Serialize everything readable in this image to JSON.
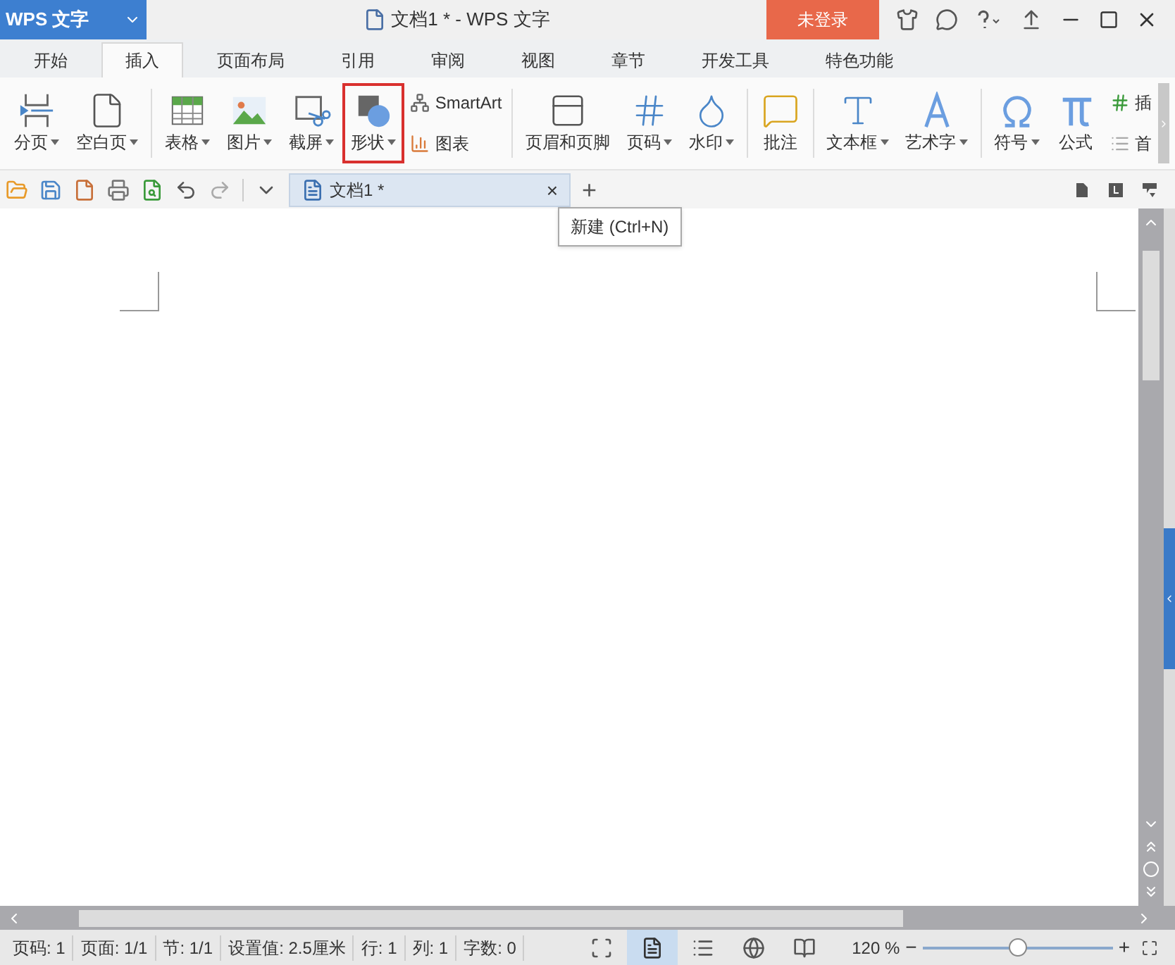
{
  "app_menu": {
    "label": "WPS 文字"
  },
  "window": {
    "title": "文档1 * - WPS 文字"
  },
  "login_button": {
    "label": "未登录"
  },
  "tabs": [
    {
      "label": "开始",
      "selected": false
    },
    {
      "label": "插入",
      "selected": true
    },
    {
      "label": "页面布局",
      "selected": false
    },
    {
      "label": "引用",
      "selected": false
    },
    {
      "label": "审阅",
      "selected": false
    },
    {
      "label": "视图",
      "selected": false
    },
    {
      "label": "章节",
      "selected": false
    },
    {
      "label": "开发工具",
      "selected": false
    },
    {
      "label": "特色功能",
      "selected": false
    }
  ],
  "ribbon": [
    {
      "kind": "large",
      "label": "分页",
      "dropdown": true,
      "highlighted": false
    },
    {
      "kind": "large",
      "label": "空白页",
      "dropdown": true,
      "highlighted": false
    },
    {
      "kind": "separator"
    },
    {
      "kind": "large",
      "label": "表格",
      "dropdown": true,
      "highlighted": false
    },
    {
      "kind": "large",
      "label": "图片",
      "dropdown": true,
      "highlighted": false
    },
    {
      "kind": "large",
      "label": "截屏",
      "dropdown": true,
      "highlighted": false
    },
    {
      "kind": "large",
      "label": "形状",
      "dropdown": true,
      "highlighted": true
    },
    {
      "kind": "stacked",
      "items": [
        {
          "label": "SmartArt"
        },
        {
          "label": "图表"
        }
      ]
    },
    {
      "kind": "separator"
    },
    {
      "kind": "large",
      "label": "页眉和页脚",
      "dropdown": false,
      "highlighted": false
    },
    {
      "kind": "large",
      "label": "页码",
      "dropdown": true,
      "highlighted": false
    },
    {
      "kind": "large",
      "label": "水印",
      "dropdown": true,
      "highlighted": false
    },
    {
      "kind": "separator"
    },
    {
      "kind": "large",
      "label": "批注",
      "dropdown": false,
      "highlighted": false
    },
    {
      "kind": "separator"
    },
    {
      "kind": "large",
      "label": "文本框",
      "dropdown": true,
      "highlighted": false
    },
    {
      "kind": "large",
      "label": "艺术字",
      "dropdown": true,
      "highlighted": false
    },
    {
      "kind": "separator"
    },
    {
      "kind": "large",
      "label": "符号",
      "dropdown": true,
      "highlighted": false
    },
    {
      "kind": "large",
      "label": "公式",
      "dropdown": false,
      "highlighted": false
    },
    {
      "kind": "stacked",
      "items": [
        {
          "label": "插"
        },
        {
          "label": "首"
        }
      ]
    }
  ],
  "document_tab": {
    "label": "文档1 *",
    "close": "×",
    "new": "+"
  },
  "tooltip": {
    "text": "新建 (Ctrl+N)"
  },
  "status_bar": {
    "items": [
      "页码: 1",
      "页面: 1/1",
      "节: 1/1",
      "设置值: 2.5厘米",
      "行: 1",
      "列: 1",
      "字数: 0"
    ],
    "views": [
      {
        "selected": false
      },
      {
        "selected": true
      },
      {
        "selected": false
      },
      {
        "selected": false
      },
      {
        "selected": false
      }
    ],
    "zoom": "120 %",
    "zoom_minus": "−",
    "zoom_plus": "+",
    "zoom_slider": {
      "level": 0.5
    }
  }
}
